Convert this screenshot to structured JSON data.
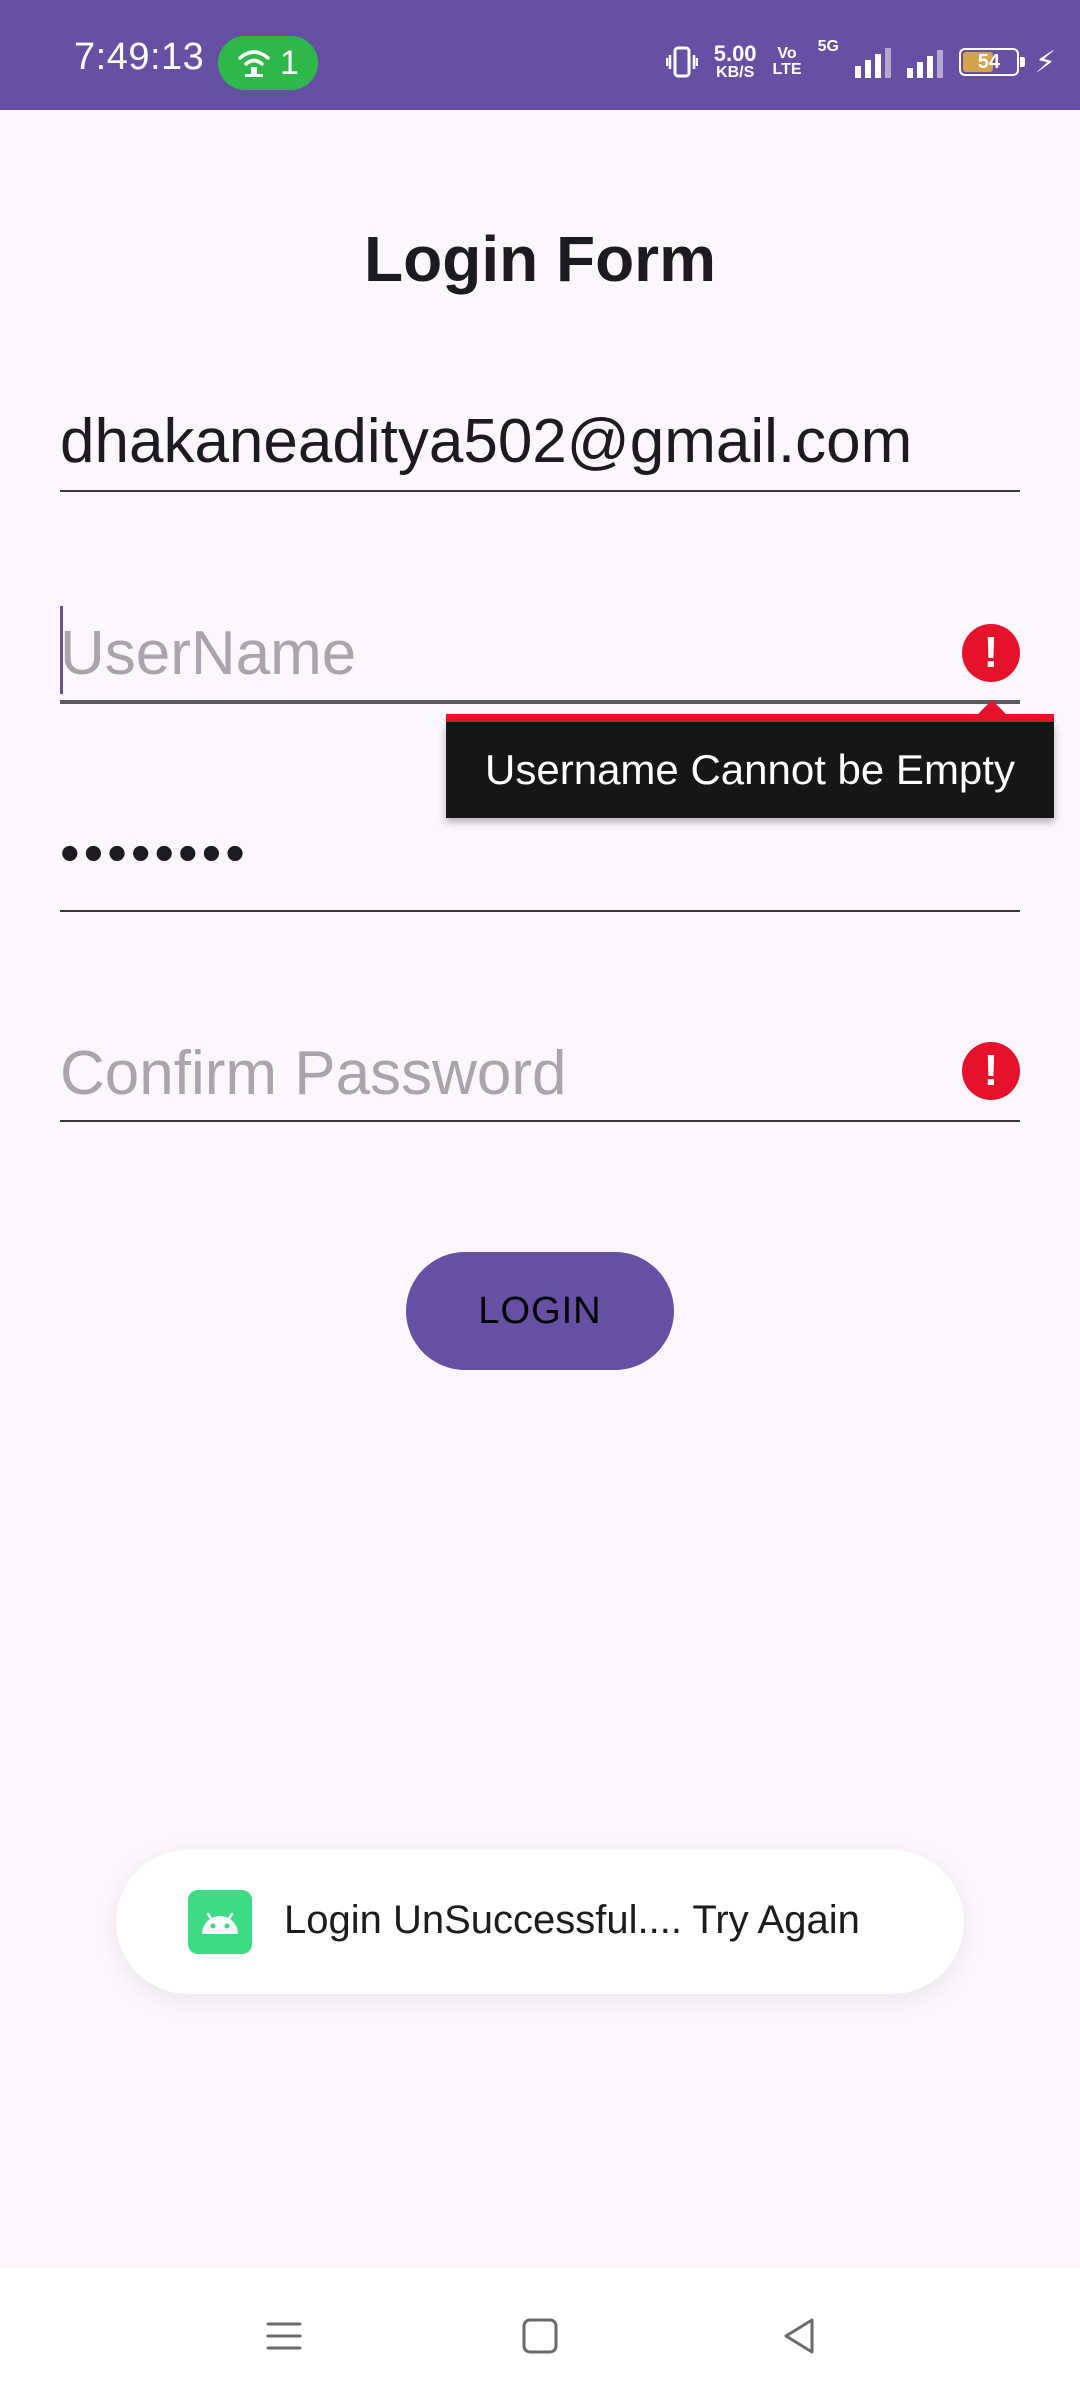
{
  "status_bar": {
    "time": "7:49:13",
    "hotspot_count": "1",
    "speed_value": "5.00",
    "speed_unit": "KB/S",
    "volte_top": "Vo",
    "volte_bottom": "LTE",
    "network": "5G",
    "battery_level": "54",
    "battery_percent": 54,
    "colors": {
      "background": "#6750a4",
      "hotspot": "#2fb84a"
    }
  },
  "form": {
    "title": "Login Form",
    "email": {
      "value": "dhakaneaditya502@gmail.com"
    },
    "username": {
      "placeholder": "UserName",
      "value": ""
    },
    "password": {
      "value": "••••••••"
    },
    "confirm_password": {
      "placeholder": "Confirm Password",
      "value": ""
    },
    "error_tooltip": "Username Cannot be Empty",
    "login_button": "LOGIN",
    "colors": {
      "accent": "#6750a4",
      "error": "#e6122c",
      "background": "#fdf7fd"
    }
  },
  "toast": {
    "message": "Login UnSuccessful.... Try Again",
    "icon": "android-app-icon"
  },
  "nav_bar": {
    "icons": [
      "menu-icon",
      "home-icon",
      "back-icon"
    ]
  }
}
